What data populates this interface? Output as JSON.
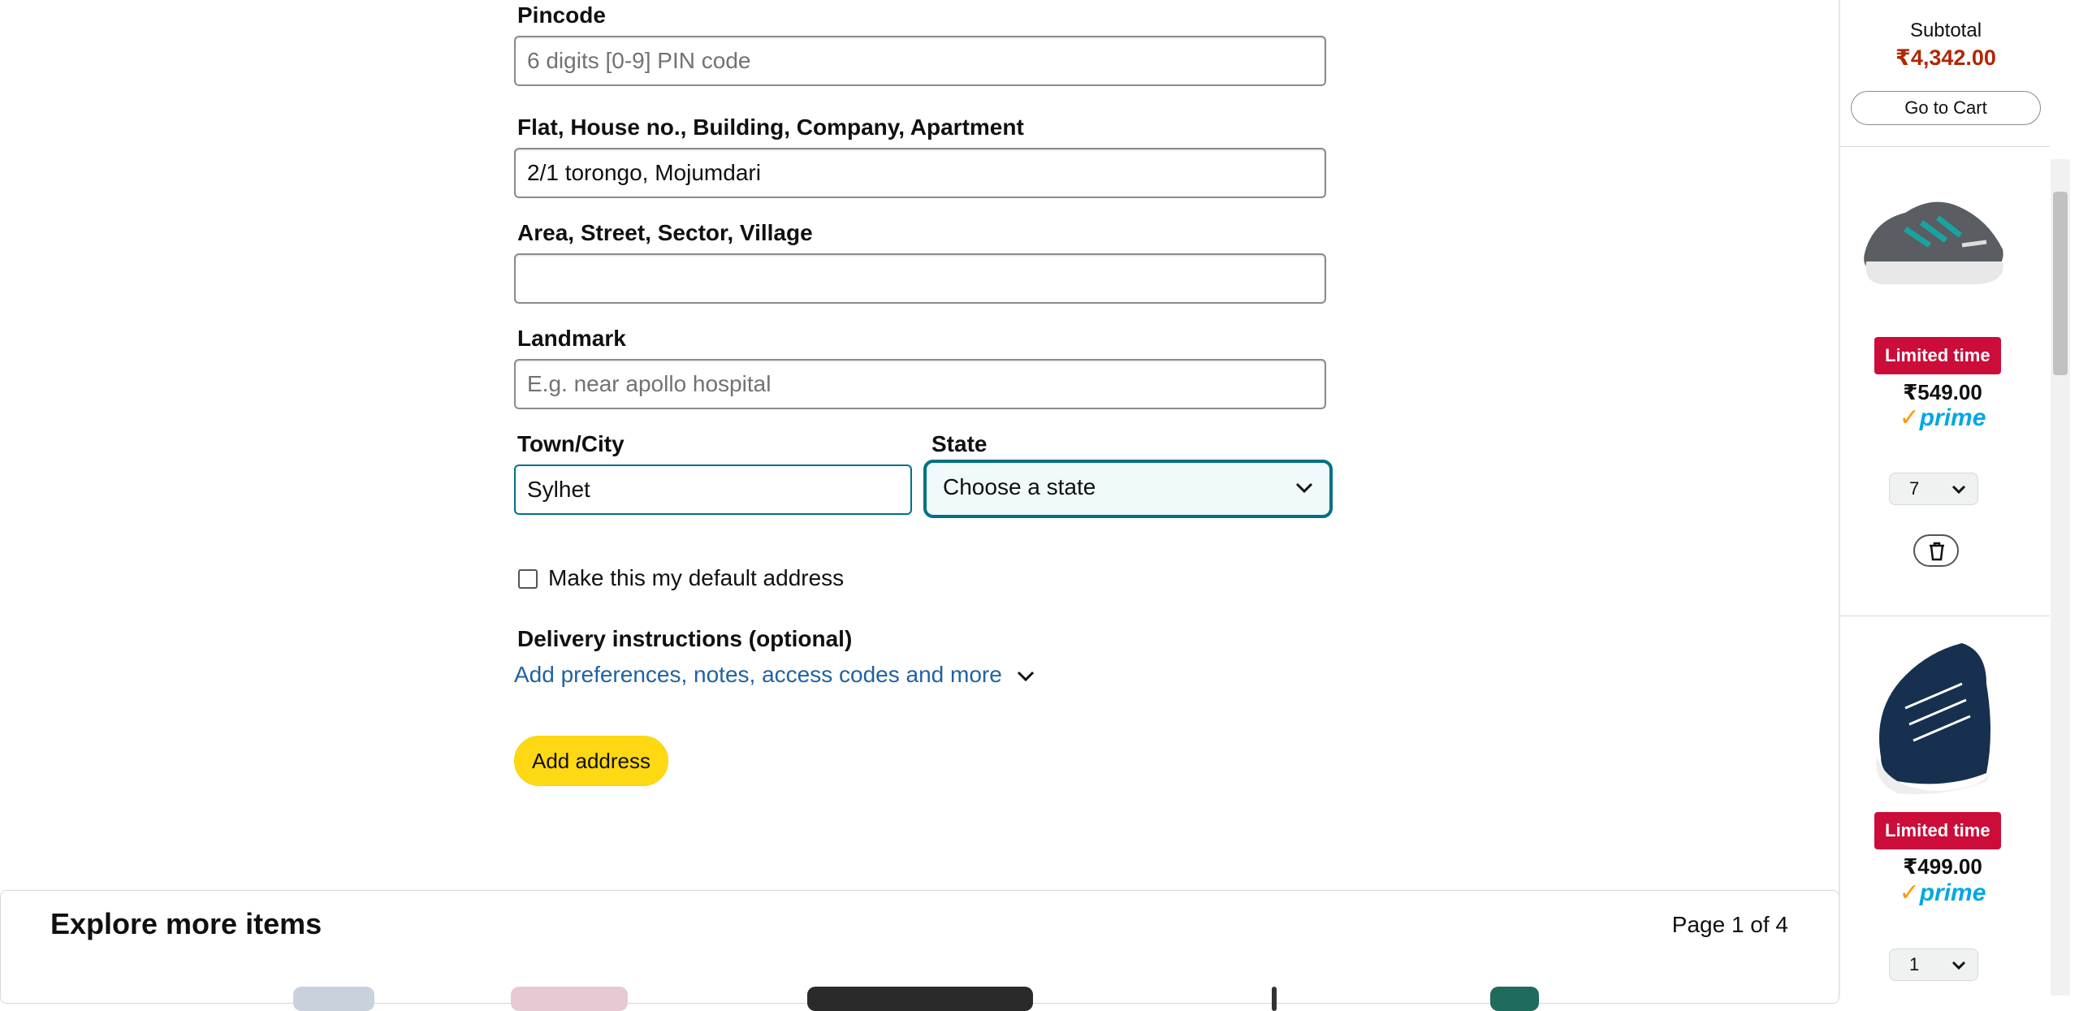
{
  "form": {
    "pincode": {
      "label": "Pincode",
      "value": "",
      "placeholder": "6 digits [0-9] PIN code"
    },
    "flat": {
      "label": "Flat, House no., Building, Company, Apartment",
      "value": "2/1 torongo, Mojumdari",
      "placeholder": ""
    },
    "area": {
      "label": "Area, Street, Sector, Village",
      "value": "",
      "placeholder": ""
    },
    "landmark": {
      "label": "Landmark",
      "value": "",
      "placeholder": "E.g. near apollo hospital"
    },
    "city": {
      "label": "Town/City",
      "value": "Sylhet"
    },
    "state": {
      "label": "State",
      "selected": "Choose a state"
    },
    "default_address_label": "Make this my default address",
    "default_address_checked": false,
    "delivery_heading": "Delivery instructions (optional)",
    "delivery_link": "Add preferences, notes, access codes and more",
    "submit_label": "Add address"
  },
  "explore": {
    "title": "Explore more items",
    "page_info": "Page 1 of 4"
  },
  "sidebar": {
    "subtotal_label": "Subtotal",
    "subtotal_value": "₹4,342.00",
    "cart_button": "Go to Cart",
    "items": [
      {
        "badge": "Limited time",
        "price": "₹549.00",
        "prime": "prime",
        "qty": "7"
      },
      {
        "badge": "Limited time",
        "price": "₹499.00",
        "prime": "prime",
        "qty": "1"
      }
    ]
  },
  "colors": {
    "accent_teal": "#007185",
    "button_yellow": "#FFD814",
    "price_red": "#B12704",
    "badge_red": "#CC0C39",
    "link_blue": "#2162A1",
    "prime_blue": "#00A8E1"
  }
}
